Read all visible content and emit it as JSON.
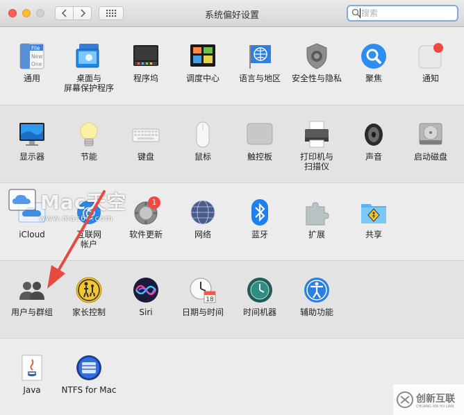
{
  "window": {
    "title": "系统偏好设置"
  },
  "search": {
    "placeholder": "搜索",
    "value": ""
  },
  "sections": [
    {
      "items": [
        {
          "label": "通用",
          "icon": "general-icon",
          "sublabel": {
            "file": "File",
            "new": "New",
            "one": "One"
          }
        },
        {
          "label": "桌面与\n屏幕保护程序",
          "icon": "desktop-screensaver-icon"
        },
        {
          "label": "程序坞",
          "icon": "dock-icon"
        },
        {
          "label": "调度中心",
          "icon": "mission-control-icon"
        },
        {
          "label": "语言与地区",
          "icon": "language-region-icon"
        },
        {
          "label": "安全性与隐私",
          "icon": "security-privacy-icon"
        },
        {
          "label": "聚焦",
          "icon": "spotlight-icon"
        },
        {
          "label": "通知",
          "icon": "notifications-icon"
        }
      ]
    },
    {
      "items": [
        {
          "label": "显示器",
          "icon": "displays-icon"
        },
        {
          "label": "节能",
          "icon": "energy-saver-icon"
        },
        {
          "label": "键盘",
          "icon": "keyboard-icon"
        },
        {
          "label": "鼠标",
          "icon": "mouse-icon"
        },
        {
          "label": "触控板",
          "icon": "trackpad-icon"
        },
        {
          "label": "打印机与\n扫描仪",
          "icon": "printer-scanner-icon"
        },
        {
          "label": "声音",
          "icon": "sound-icon"
        },
        {
          "label": "启动磁盘",
          "icon": "startup-disk-icon"
        }
      ]
    },
    {
      "items": [
        {
          "label": "iCloud",
          "icon": "icloud-icon"
        },
        {
          "label": "互联网\n帐户",
          "icon": "internet-accounts-icon"
        },
        {
          "label": "软件更新",
          "icon": "software-update-icon",
          "badge": "1"
        },
        {
          "label": "网络",
          "icon": "network-icon"
        },
        {
          "label": "蓝牙",
          "icon": "bluetooth-icon"
        },
        {
          "label": "扩展",
          "icon": "extensions-icon"
        },
        {
          "label": "共享",
          "icon": "sharing-icon"
        }
      ]
    },
    {
      "items": [
        {
          "label": "用户与群组",
          "icon": "users-groups-icon"
        },
        {
          "label": "家长控制",
          "icon": "parental-controls-icon"
        },
        {
          "label": "Siri",
          "icon": "siri-icon"
        },
        {
          "label": "日期与时间",
          "icon": "date-time-icon",
          "calendar_day": "18"
        },
        {
          "label": "时间机器",
          "icon": "time-machine-icon"
        },
        {
          "label": "辅助功能",
          "icon": "accessibility-icon"
        }
      ]
    },
    {
      "items": [
        {
          "label": "Java",
          "icon": "java-icon"
        },
        {
          "label": "NTFS for Mac",
          "icon": "ntfs-for-mac-icon"
        }
      ]
    }
  ],
  "watermarks": {
    "mac69_title": "Mac天空",
    "mac69_url": "www.mac69.com",
    "cdcxhl_title": "创新互联",
    "cdcxhl_sub": "CHUANG XIN HU LIAN"
  },
  "colors": {
    "arrow": "#e8493f",
    "search_focus": "#7fa9e6"
  }
}
